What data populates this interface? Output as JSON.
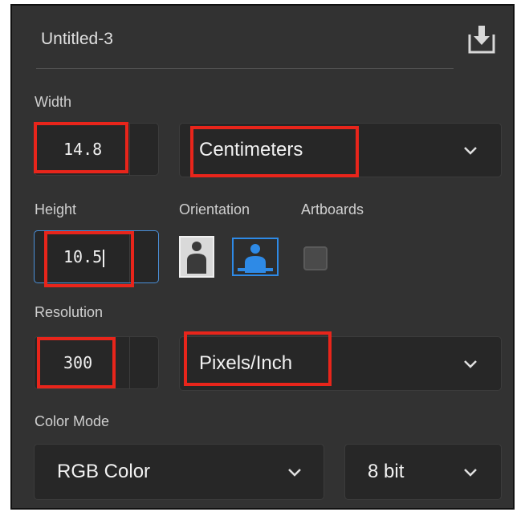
{
  "document": {
    "name": "Untitled-3"
  },
  "width": {
    "label": "Width",
    "value": "14.8",
    "unit": "Centimeters"
  },
  "height": {
    "label": "Height",
    "value": "10.5"
  },
  "orientation": {
    "label": "Orientation",
    "selected": "landscape"
  },
  "artboards": {
    "label": "Artboards",
    "checked": false
  },
  "resolution": {
    "label": "Resolution",
    "value": "300",
    "unit": "Pixels/Inch"
  },
  "color_mode": {
    "label": "Color Mode",
    "mode": "RGB Color",
    "bit_depth": "8 bit"
  },
  "colors": {
    "panel_bg": "#323232",
    "focus_border": "#4a8fd8",
    "highlight_red": "#e8251b",
    "orientation_active": "#2e8ae6"
  }
}
